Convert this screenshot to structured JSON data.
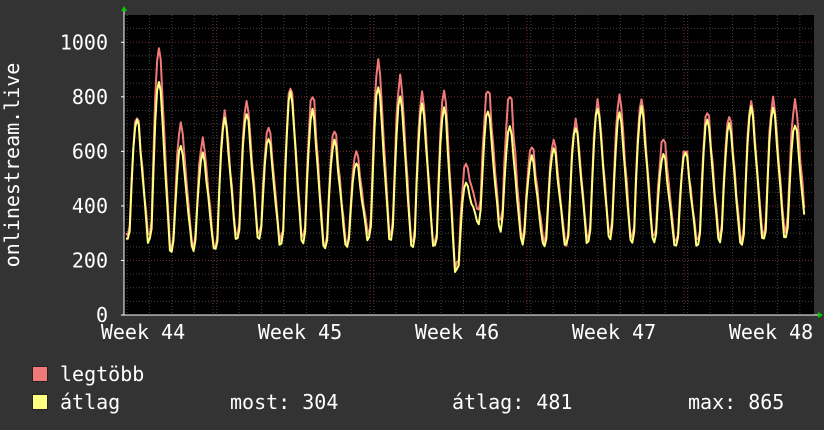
{
  "chart_data": {
    "type": "line",
    "ylabel": "onlinestream.live",
    "x_tick_labels": [
      "Week 44",
      "Week 45",
      "Week 46",
      "Week 47",
      "Week 48"
    ],
    "y_ticks": [
      0,
      200,
      400,
      600,
      800,
      1000
    ],
    "ylim": [
      0,
      1100
    ],
    "grid": true,
    "series": [
      {
        "name": "legtöbb",
        "color": "#f07a7a",
        "daily_peaks": [
          730,
          980,
          700,
          640,
          740,
          780,
          690,
          840,
          810,
          680,
          600,
          930,
          870,
          810,
          820,
          560,
          830,
          810,
          620,
          640,
          710,
          780,
          800,
          790,
          650,
          610,
          750,
          730,
          780,
          790,
          780
        ],
        "daily_troughs": [
          300,
          290,
          250,
          260,
          250,
          300,
          310,
          280,
          290,
          260,
          270,
          300,
          300,
          270,
          260,
          180,
          400,
          360,
          300,
          280,
          270,
          290,
          310,
          290,
          300,
          280,
          280,
          300,
          280,
          300,
          320
        ]
      },
      {
        "name": "átlag",
        "color": "#ffff80",
        "daily_peaks": [
          720,
          860,
          620,
          590,
          720,
          740,
          650,
          820,
          750,
          640,
          560,
          840,
          800,
          770,
          760,
          490,
          750,
          690,
          580,
          610,
          690,
          760,
          740,
          760,
          590,
          600,
          720,
          700,
          760,
          760,
          700
        ],
        "daily_troughs": [
          280,
          270,
          240,
          250,
          240,
          280,
          290,
          260,
          270,
          250,
          260,
          280,
          280,
          250,
          250,
          160,
          350,
          330,
          280,
          260,
          260,
          270,
          290,
          270,
          280,
          260,
          260,
          280,
          260,
          280,
          290
        ]
      }
    ]
  },
  "legend": {
    "max_label": "legtöbb",
    "avg_label": "átlag"
  },
  "stats": {
    "now": "most: 304",
    "avg": "átlag: 481",
    "max": "max: 865"
  },
  "colors": {
    "background": "#333333",
    "plot_background": "#000000",
    "grid_major": "#7a2e2e",
    "grid_minor": "#444444",
    "axis": "#ffffff",
    "arrow": "#00cc00"
  }
}
